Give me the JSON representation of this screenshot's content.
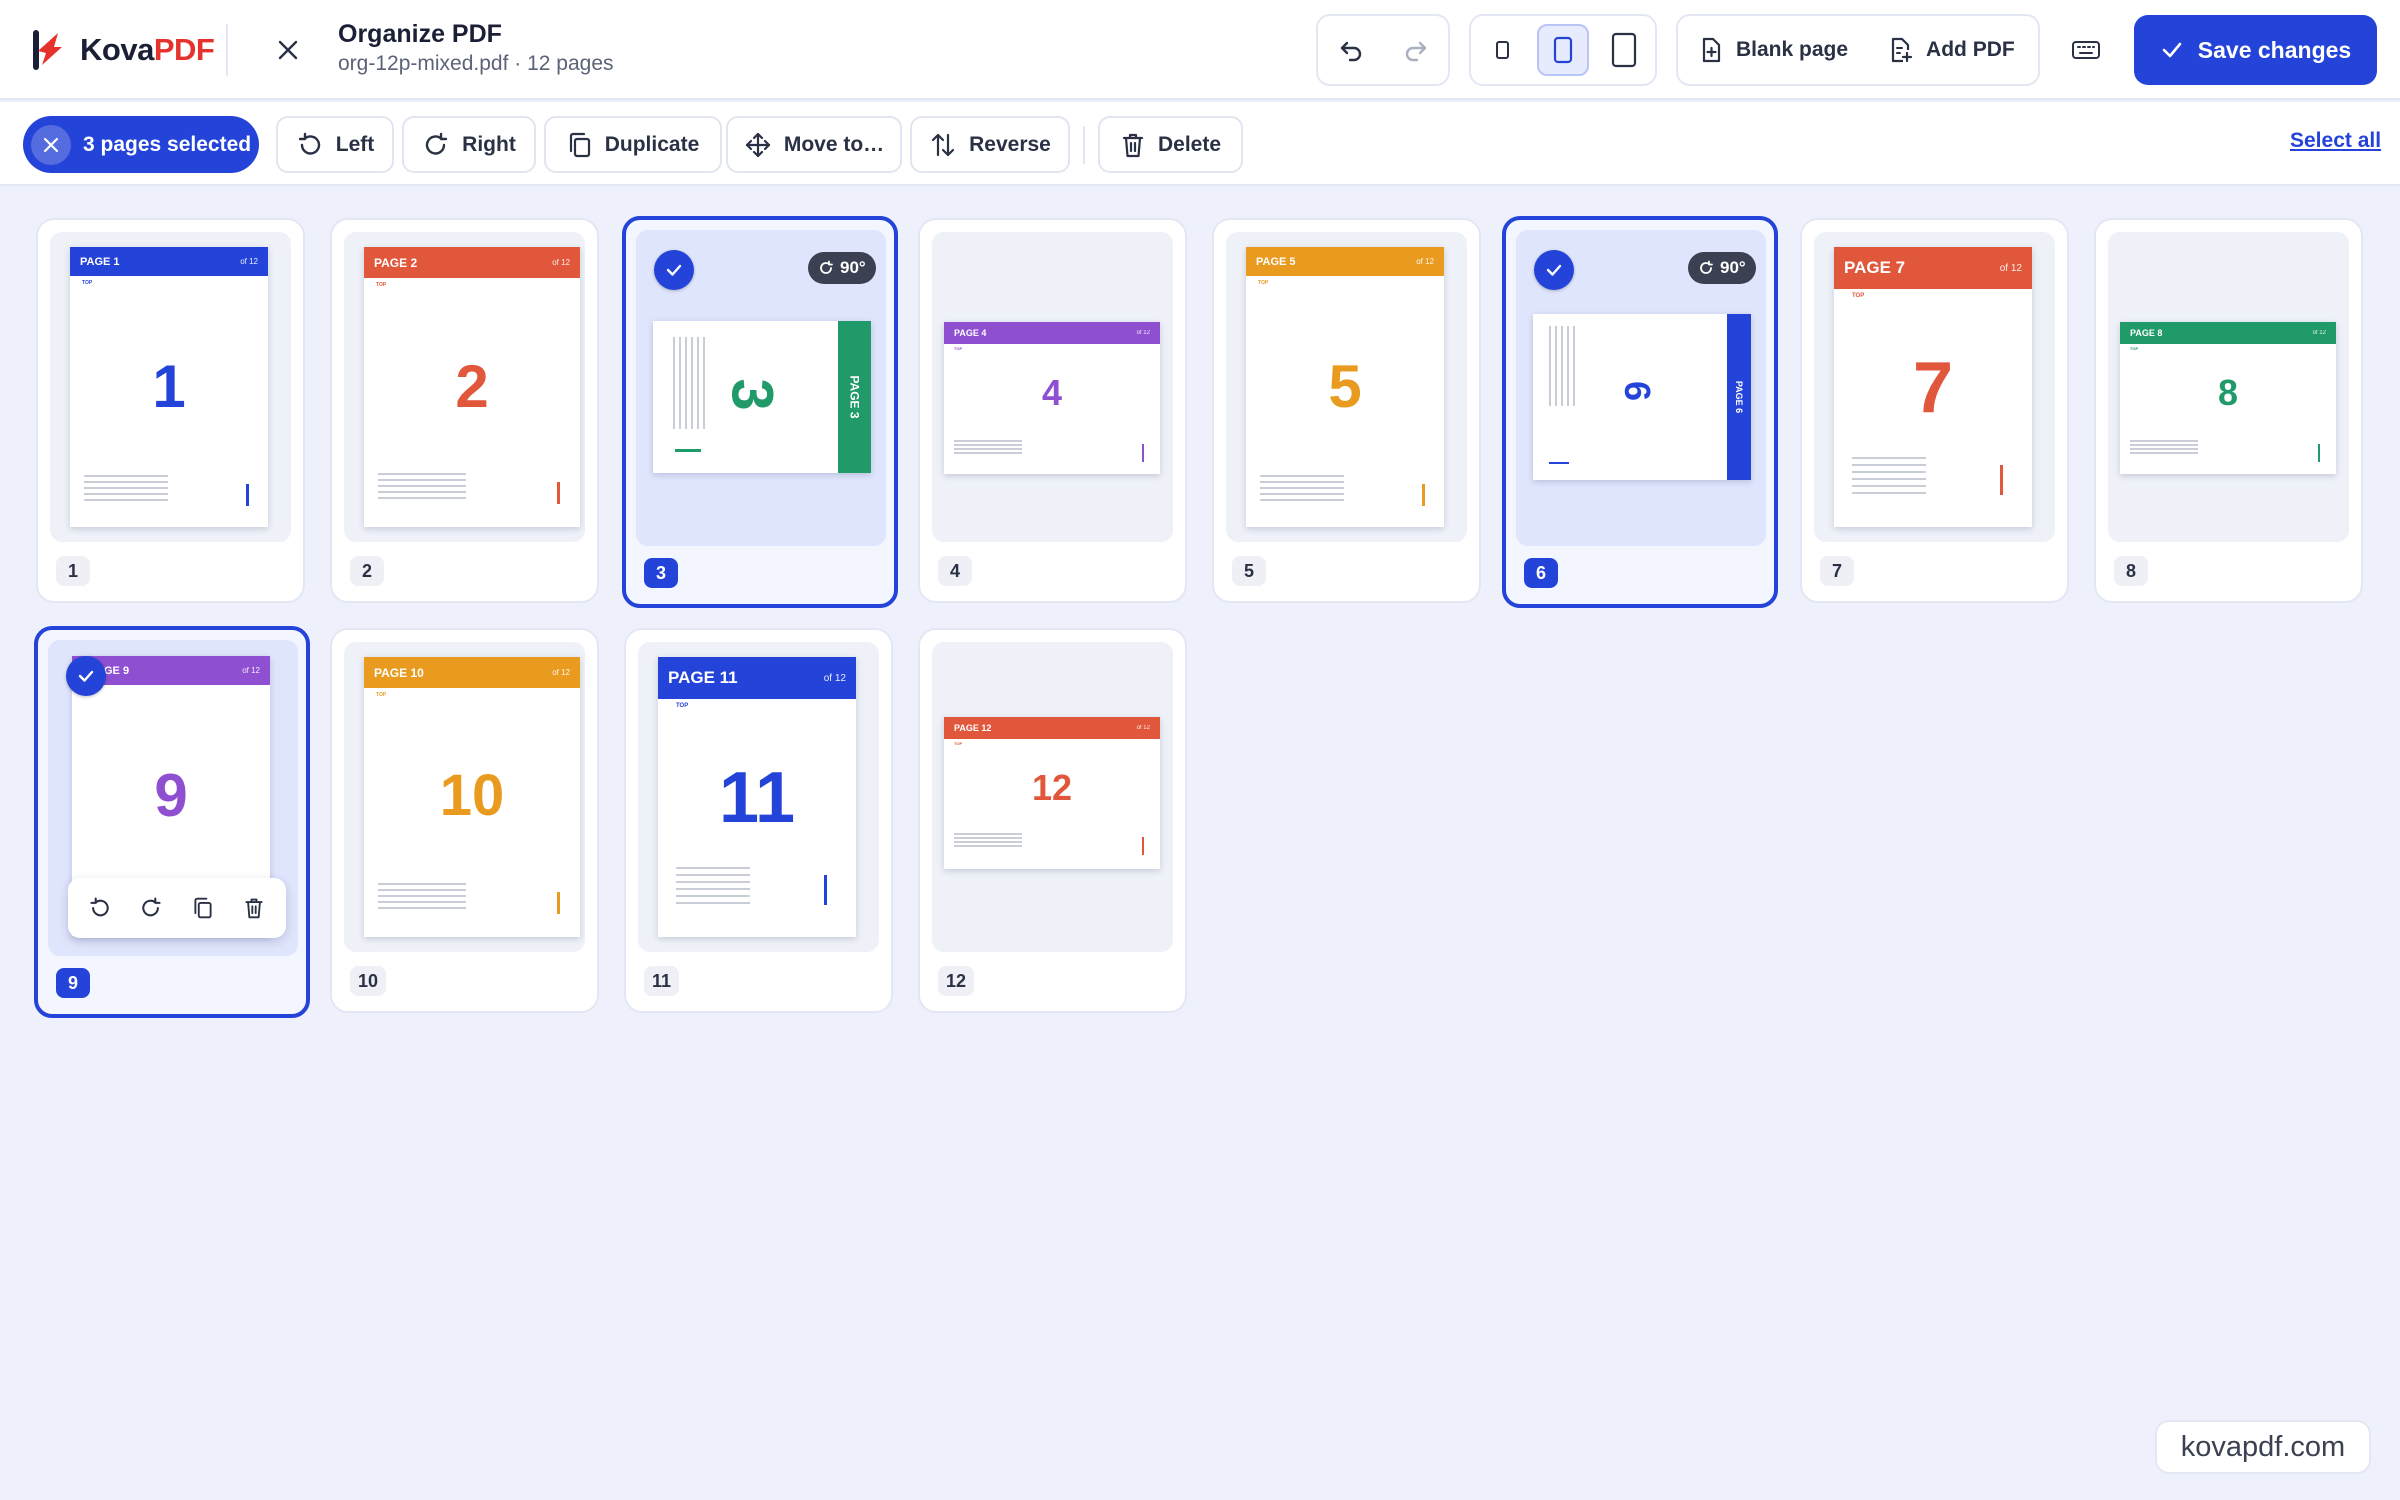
{
  "app": {
    "name_main": "Kova",
    "name_accent": "PDF"
  },
  "header": {
    "title": "Organize PDF",
    "filename": "org-12p-mixed.pdf",
    "page_count": "· 12 pages",
    "blank_page_label": "Blank page",
    "add_pdf_label": "Add PDF",
    "save_label": "Save changes",
    "view_size_selected": "medium"
  },
  "selection_bar": {
    "count_label": "3 pages selected",
    "actions": [
      "Left",
      "Right",
      "Duplicate",
      "Move to…",
      "Reverse",
      "Delete"
    ],
    "select_all": "Select all"
  },
  "pages": [
    {
      "num": "1",
      "title": "PAGE 1",
      "of": "of 12",
      "color": "#2443d8",
      "selected": false,
      "rotation": ""
    },
    {
      "num": "2",
      "title": "PAGE 2",
      "of": "of 12",
      "color": "#e0573b",
      "selected": false,
      "rotation": ""
    },
    {
      "num": "3",
      "title": "PAGE 3",
      "of": "of 12",
      "color": "#1f9a68",
      "selected": true,
      "rotation": "90°"
    },
    {
      "num": "4",
      "title": "PAGE 4",
      "of": "of 12",
      "color": "#8e4fd1",
      "selected": false,
      "rotation": ""
    },
    {
      "num": "5",
      "title": "PAGE 5",
      "of": "of 12",
      "color": "#e99b1f",
      "selected": false,
      "rotation": ""
    },
    {
      "num": "6",
      "title": "PAGE 6",
      "of": "of 12",
      "color": "#2443d8",
      "selected": true,
      "rotation": "90°"
    },
    {
      "num": "7",
      "title": "PAGE 7",
      "of": "of 12",
      "color": "#e0573b",
      "selected": false,
      "rotation": ""
    },
    {
      "num": "8",
      "title": "PAGE 8",
      "of": "of 12",
      "color": "#1f9a68",
      "selected": false,
      "rotation": ""
    },
    {
      "num": "9",
      "title": "GE 9",
      "of": "of 12",
      "color": "#8e4fd1",
      "selected": true,
      "rotation": ""
    },
    {
      "num": "10",
      "title": "PAGE 10",
      "of": "of 12",
      "color": "#e99b1f",
      "selected": false,
      "rotation": ""
    },
    {
      "num": "11",
      "title": "PAGE 11",
      "of": "of 12",
      "color": "#2443d8",
      "selected": false,
      "rotation": ""
    },
    {
      "num": "12",
      "title": "PAGE 12",
      "of": "of 12",
      "color": "#e0573b",
      "selected": false,
      "rotation": ""
    }
  ],
  "top_marker": "TOP",
  "watermark": "kovapdf.com",
  "colors": {
    "accent": "#2443d8",
    "brand_red": "#e5322d"
  }
}
